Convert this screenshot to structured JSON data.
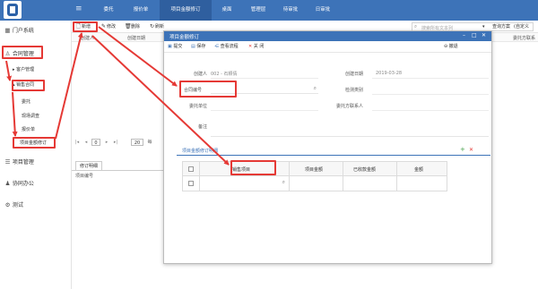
{
  "topnav": {
    "menu_icon": "menu-icon",
    "items": [
      "委托",
      "报价单",
      "项目金额修订",
      "桌面",
      "管理层",
      "待审批",
      "日审批"
    ],
    "active_index": 2
  },
  "sidebar": {
    "items": [
      {
        "label": "门户系统",
        "icon": "grid-icon"
      },
      {
        "label": "合同管理",
        "icon": "user-icon"
      },
      {
        "label": "客户管理"
      },
      {
        "label": "销售合同"
      },
      {
        "label": "委托"
      },
      {
        "label": "现场调查"
      },
      {
        "label": "报价单"
      },
      {
        "label": "项目金额修订"
      },
      {
        "label": "项目管理",
        "icon": "list-icon"
      },
      {
        "label": "协同办公",
        "icon": "person-icon"
      },
      {
        "label": "测试",
        "icon": "gear-icon"
      }
    ]
  },
  "toolbar": {
    "add": "新增",
    "edit": "修改",
    "delete": "删除",
    "refresh": "刷新",
    "search_placeholder": "搜索所有文本列",
    "query_scheme": "查询方案",
    "custom": "(自定义"
  },
  "grid": {
    "columns": [
      "创建人",
      "创建日期",
      "委托方联系"
    ]
  },
  "pager": {
    "page": "0",
    "page_size": "20",
    "per_page_prefix": "每"
  },
  "subtabs": {
    "tab": "修订明细",
    "column": "项目编号"
  },
  "modal": {
    "title": "项目金额修订",
    "save_submit": "提交",
    "save": "保存",
    "view_flow": "查看流程",
    "close": "关 闭",
    "back": "撤退",
    "fields": {
      "creator_label": "创建人",
      "creator_value": "002 - 石颖倩",
      "created_date_label": "创建日期",
      "created_date_value": "2019-03-28",
      "contract_no_label": "合同编号",
      "inspection_label": "检测类别",
      "client_label": "委托单位",
      "client_contact_label": "委托方联系人",
      "remark_label": "备注"
    },
    "detail_section_title": "项目金额修订明细",
    "detail_columns": [
      "销售项目",
      "项目金额",
      "已收款金额",
      "金额"
    ]
  },
  "colors": {
    "topbar": "#3d73b8",
    "highlight": "#e53935"
  }
}
